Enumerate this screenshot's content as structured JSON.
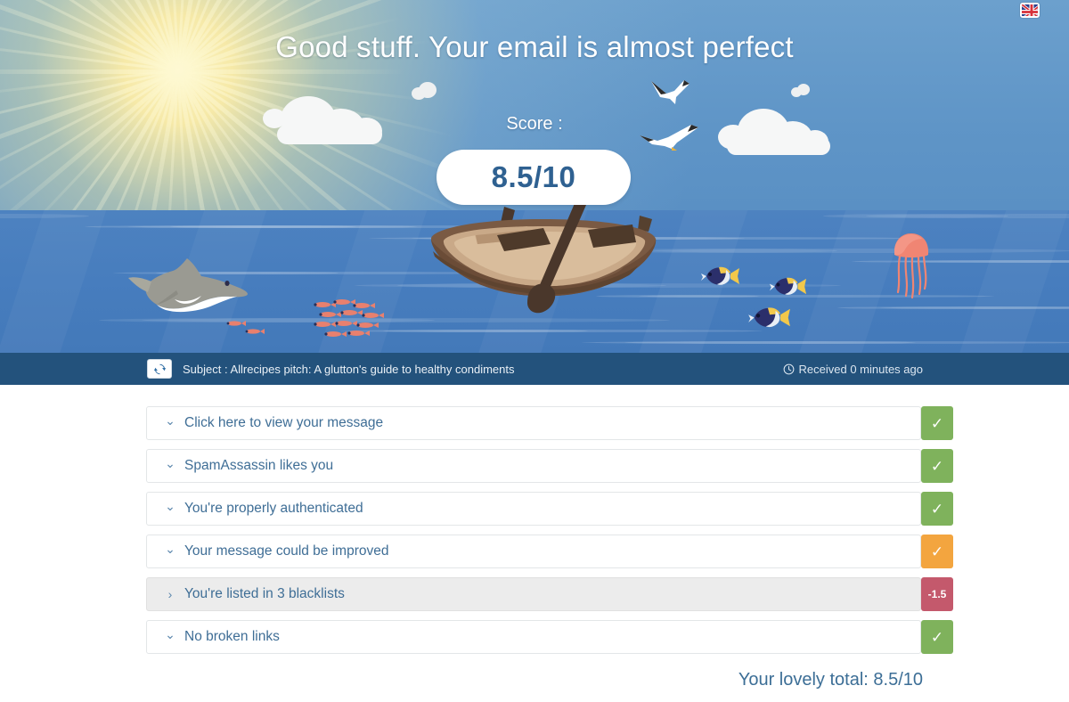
{
  "hero": {
    "title": "Good stuff. Your email is almost perfect",
    "score_label": "Score :",
    "score_value": "8.5/10",
    "language_flag": "uk-flag-icon",
    "scene_icons": [
      "sun-icon",
      "cloud-icon",
      "seagull-icon",
      "rowboat-icon",
      "dolphin-icon",
      "blue-tang-fish-icon",
      "jellyfish-icon",
      "fish-school-icon"
    ]
  },
  "subject_bar": {
    "refresh_icon": "refresh-icon",
    "subject": "Subject : Allrecipes pitch: A glutton's guide to healthy condiments",
    "clock_icon": "clock-icon",
    "received": "Received 0 minutes ago"
  },
  "results": {
    "rows": [
      {
        "label": "Click here to view your message",
        "chevron": "chevron-down-icon",
        "expanded": true,
        "badge_type": "ok",
        "badge_text": "✓"
      },
      {
        "label": "SpamAssassin likes you",
        "chevron": "chevron-down-icon",
        "expanded": true,
        "badge_type": "ok",
        "badge_text": "✓"
      },
      {
        "label": "You're properly authenticated",
        "chevron": "chevron-down-icon",
        "expanded": true,
        "badge_type": "ok",
        "badge_text": "✓"
      },
      {
        "label": "Your message could be improved",
        "chevron": "chevron-down-icon",
        "expanded": true,
        "badge_type": "warn",
        "badge_text": "✓"
      },
      {
        "label": "You're listed in 3 blacklists",
        "chevron": "chevron-right-icon",
        "expanded": false,
        "badge_type": "bad",
        "badge_text": "-1.5"
      },
      {
        "label": "No broken links",
        "chevron": "chevron-down-icon",
        "expanded": true,
        "badge_type": "ok",
        "badge_text": "✓"
      }
    ]
  },
  "footer": {
    "total": "Your lovely total: 8.5/10"
  },
  "colors": {
    "sky": "#6096c8",
    "sea": "#4a80c0",
    "bar": "#23527c",
    "ok": "#7fb25c",
    "warn": "#f3a53f",
    "bad": "#c4596c",
    "text_blue": "#3c6e96"
  }
}
